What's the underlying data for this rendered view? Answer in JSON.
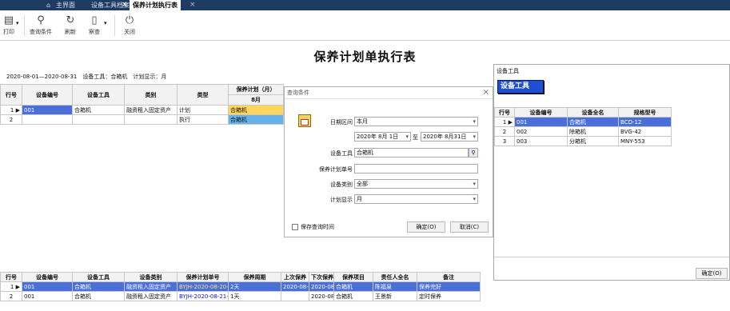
{
  "tabs": [
    {
      "label": "主界面"
    },
    {
      "label": "设备工具档案"
    },
    {
      "label": "保养计划执行表"
    }
  ],
  "toolbar": {
    "print": "打印",
    "query": "查询条件",
    "refresh": "刷新",
    "view": "察查",
    "close": "关闭"
  },
  "report": {
    "title": "保养计划单执行表",
    "meta": "2020-08-01—2020-08-31　设备工具：合箱机　计划显示：月"
  },
  "plan_table": {
    "headers": [
      "行号",
      "设备编号",
      "设备工具",
      "类别",
      "类型",
      "保养计划（月）"
    ],
    "subheader": "8月",
    "rows": [
      {
        "no": "1",
        "code": "001",
        "tool": "合箱机",
        "category": "融资租入固定资产",
        "type": "计划",
        "cell": "合箱机"
      },
      {
        "no": "2",
        "code": "",
        "tool": "",
        "category": "",
        "type": "执行",
        "cell": "合箱机"
      }
    ]
  },
  "query_dialog": {
    "title": "查询条件",
    "date_label": "日期区间",
    "date_value": "本月",
    "date_from": "2020年 8月 1日",
    "date_to_sep": "至",
    "date_to": "2020年 8月31日",
    "tool_label": "设备工具",
    "tool_value": "合箱机",
    "plan_no_label": "保养计划单号",
    "plan_no_value": "",
    "category_label": "设备类别",
    "category_value": "全部",
    "display_label": "计划显示",
    "display_value": "月",
    "save_time_label": "保存查询时间",
    "ok": "确定(O)",
    "cancel": "取消(C)"
  },
  "tool_panel": {
    "title": "设备工具",
    "header_label": "设备工具",
    "headers": [
      "行号",
      "设备编号",
      "设备全名",
      "规格型号"
    ],
    "rows": [
      {
        "no": "1",
        "code": "001",
        "name": "合箱机",
        "spec": "BCD-12"
      },
      {
        "no": "2",
        "code": "002",
        "name": "除箱机",
        "spec": "BVG-42"
      },
      {
        "no": "3",
        "code": "003",
        "name": "分箱机",
        "spec": "MNY-553"
      }
    ],
    "ok": "确定(O)"
  },
  "detail_table": {
    "headers": [
      "行号",
      "设备编号",
      "设备工具",
      "设备类别",
      "保养计划单号",
      "保养周期",
      "上次保养",
      "下次保养",
      "保养项目",
      "责任人全名",
      "备注"
    ],
    "rows": [
      {
        "no": "1",
        "code": "001",
        "tool": "合箱机",
        "category": "融资租入固定资产",
        "plan_no": "BYJH-2020-08-20-0",
        "cycle": "2天",
        "last": "2020-08-",
        "next": "2020-08-",
        "item": "合箱机",
        "person": "陈福泉",
        "note": "保养完好"
      },
      {
        "no": "2",
        "code": "001",
        "tool": "合箱机",
        "category": "融资租入固定资产",
        "plan_no": "BYJH-2020-08-21-0",
        "cycle": "1天",
        "last": "",
        "next": "2020-08-",
        "item": "合箱机",
        "person": "王景新",
        "note": "定时保养"
      }
    ]
  },
  "colors": {
    "tabbar": "#1e3b64",
    "selection": "#4a6fd8",
    "plan": "#ffd65c",
    "exec": "#65b2ea",
    "panel_header": "#1f4fd0"
  }
}
